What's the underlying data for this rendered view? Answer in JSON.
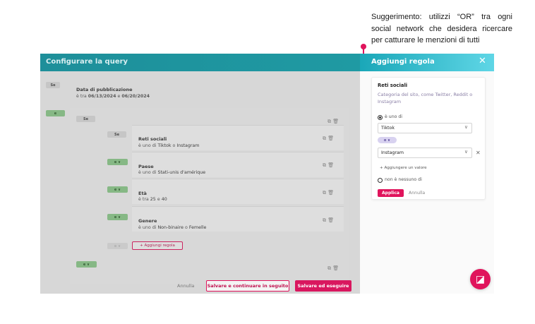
{
  "tooltip": {
    "text": "Suggerimento: utilizzi “OR” tra ogni social network che desidera ricercare per catturare le menzioni di tutti"
  },
  "main": {
    "title": "Configurare la query",
    "se_label": "Se",
    "e_label": "e",
    "e_dropdown_label": "e ∨",
    "date_block": {
      "title": "Data di pubblicazione",
      "prefix": "è tra ",
      "from": "06/13/2024",
      "mid": " e ",
      "to": "06/20/2024"
    },
    "rules": [
      {
        "title": "Reti sociali",
        "prefix": "è uno di ",
        "v1": "Tiktok",
        "sep": " o ",
        "v2": "Instagram"
      },
      {
        "title": "Paese",
        "prefix": "è uno di ",
        "v1": "Stati-unis d'amérique",
        "sep": "",
        "v2": ""
      },
      {
        "title": "Età",
        "prefix": "è tra ",
        "v1": "25",
        "sep": " e ",
        "v2": "40"
      },
      {
        "title": "Genere",
        "prefix": "è uno di ",
        "v1": "Non-binaire",
        "sep": " o ",
        "v2": "Femelle"
      }
    ],
    "add_rule_label": "+ Aggiungi regola",
    "icons_glyph": "⧉ 🗑",
    "cancel_label": "Annulla",
    "save_continue_label": "Salvare e continuare in seguito",
    "save_run_label": "Salvare ed eseguire"
  },
  "panel": {
    "title": "Aggiungi regola",
    "close_glyph": "✕",
    "card": {
      "title": "Reti sociali",
      "description": "Categoria del sito, come Twitter, Reddit o Instagram",
      "option_one": "è uno di",
      "select_one_value": "Tiktok",
      "or_label": "o ∨",
      "select_two_value": "Instagram",
      "add_value_label": "+ Aggiungere un valore",
      "option_none": "non è nessuno di",
      "apply_label": "Applica",
      "cancel_label": "Annulla",
      "chevron_glyph": "∨",
      "remove_glyph": "✕"
    }
  },
  "help_glyph": "◪",
  "colors": {
    "teal": "#1e8f9a",
    "accent": "#e0145c",
    "green": "#8cc98a"
  }
}
